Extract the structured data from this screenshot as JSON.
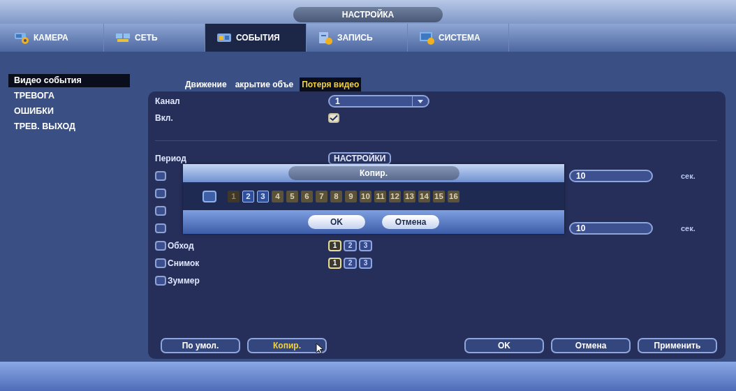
{
  "window": {
    "title": "НАСТРОЙКА"
  },
  "tabs": [
    {
      "label": "КАМЕРА",
      "kind": "camera",
      "selected": false
    },
    {
      "label": "СЕТЬ",
      "kind": "network",
      "selected": false
    },
    {
      "label": "СОБЫТИЯ",
      "kind": "events",
      "selected": true
    },
    {
      "label": "ЗАПИСЬ",
      "kind": "record",
      "selected": false
    },
    {
      "label": "СИСТЕМА",
      "kind": "system",
      "selected": false
    }
  ],
  "sidebar": {
    "items": [
      {
        "label": "Видео события",
        "selected": true
      },
      {
        "label": "ТРЕВОГА",
        "selected": false
      },
      {
        "label": "ОШИБКИ",
        "selected": false
      },
      {
        "label": "ТРЕВ. ВЫХОД",
        "selected": false
      }
    ]
  },
  "subtabs": [
    {
      "label": "Движение",
      "selected": false
    },
    {
      "label": "акрытие объе",
      "selected": false
    },
    {
      "label": "Потеря видео",
      "selected": true
    }
  ],
  "form": {
    "channel": {
      "label": "Канал",
      "value": "1"
    },
    "enable": {
      "label": "Вкл.",
      "checked": true
    },
    "period": {
      "label": "Период",
      "button": "НАСТРОЙКИ"
    },
    "rows": [
      {
        "kind": "check",
        "checked": false,
        "value": "10",
        "unit": "сек."
      },
      {
        "kind": "check",
        "checked": false
      },
      {
        "kind": "check",
        "checked": false
      },
      {
        "kind": "check",
        "checked": false,
        "value": "10",
        "unit": "сек."
      },
      {
        "kind": "outputs",
        "label": "Обход",
        "checked": false,
        "outputs": [
          {
            "label": "1",
            "selected": true
          },
          {
            "label": "2",
            "selected": false
          },
          {
            "label": "3",
            "selected": false
          }
        ]
      },
      {
        "kind": "outputs",
        "label": "Снимок",
        "checked": false,
        "outputs": [
          {
            "label": "1",
            "selected": true
          },
          {
            "label": "2",
            "selected": false
          },
          {
            "label": "3",
            "selected": false
          }
        ]
      },
      {
        "kind": "check",
        "label": "Зуммер",
        "checked": false
      }
    ]
  },
  "buttons": [
    {
      "label": "По умол.",
      "highlighted": false
    },
    {
      "label": "Копир.",
      "highlighted": true
    },
    {
      "label": "OK",
      "highlighted": false
    },
    {
      "label": "Отмена",
      "highlighted": false
    },
    {
      "label": "Применить",
      "highlighted": false
    }
  ],
  "dialog": {
    "title": "Копир.",
    "all_checked": false,
    "channels": [
      {
        "label": "1",
        "selected": false,
        "disabled": true
      },
      {
        "label": "2",
        "selected": true,
        "disabled": false
      },
      {
        "label": "3",
        "selected": true,
        "disabled": false
      },
      {
        "label": "4",
        "selected": false,
        "disabled": false
      },
      {
        "label": "5",
        "selected": false,
        "disabled": false
      },
      {
        "label": "6",
        "selected": false,
        "disabled": false
      },
      {
        "label": "7",
        "selected": false,
        "disabled": false
      },
      {
        "label": "8",
        "selected": false,
        "disabled": false
      },
      {
        "label": "9",
        "selected": false,
        "disabled": false
      },
      {
        "label": "10",
        "selected": false,
        "disabled": false
      },
      {
        "label": "11",
        "selected": false,
        "disabled": false
      },
      {
        "label": "12",
        "selected": false,
        "disabled": false
      },
      {
        "label": "13",
        "selected": false,
        "disabled": false
      },
      {
        "label": "14",
        "selected": false,
        "disabled": false
      },
      {
        "label": "15",
        "selected": false,
        "disabled": false
      },
      {
        "label": "16",
        "selected": false,
        "disabled": false
      }
    ],
    "buttons": [
      "OK",
      "Отмена"
    ]
  }
}
